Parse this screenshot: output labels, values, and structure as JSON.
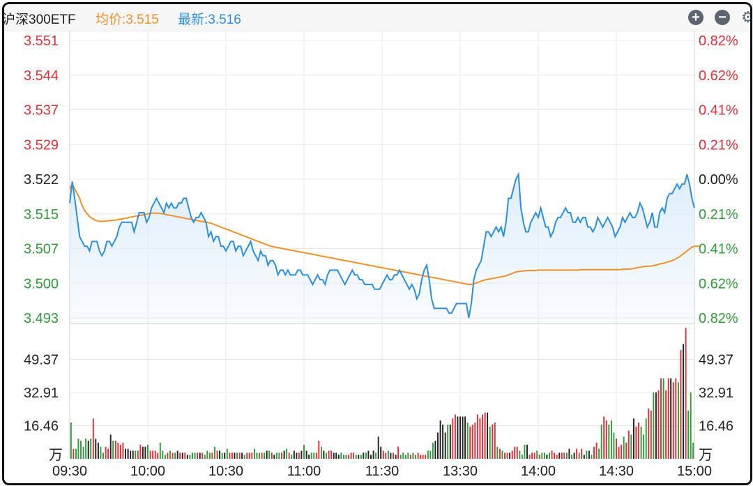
{
  "header": {
    "name": "沪深300ETF",
    "avg_label": "均价:3.515",
    "last_label": "最新:3.516",
    "zoom_in_icon": "plus-circle-icon",
    "zoom_out_icon": "minus-circle-icon",
    "settings_icon": "gear-icon"
  },
  "colors": {
    "up": "#e0303a",
    "down": "#2f9e3a",
    "flat": "#222222",
    "price_line": "#2b8fe0",
    "avg_line": "#f0902a",
    "area_fill": "#dcecfb",
    "grid": "#e8e8e8"
  },
  "chart_data": [
    {
      "type": "line",
      "name": "price",
      "base_price": 3.522,
      "price_ticks": [
        "3.551",
        "3.544",
        "3.537",
        "3.529",
        "3.522",
        "3.515",
        "3.507",
        "3.500",
        "3.493"
      ],
      "pct_ticks": [
        "0.82%",
        "0.62%",
        "0.41%",
        "0.21%",
        "0.00%",
        "0.21%",
        "0.41%",
        "0.62%",
        "0.82%"
      ],
      "ylim": [
        3.493,
        3.551
      ],
      "x_ticks": [
        "09:30",
        "10:00",
        "10:30",
        "11:00",
        "11:30",
        "13:30",
        "14:00",
        "14:30",
        "15:00"
      ],
      "series": [
        {
          "name": "最新",
          "values": [
            3.517,
            3.5215,
            3.518,
            3.514,
            3.51,
            3.509,
            3.508,
            3.508,
            3.507,
            3.509,
            3.509,
            3.509,
            3.507,
            3.506,
            3.507,
            3.509,
            3.509,
            3.508,
            3.509,
            3.51,
            3.512,
            3.513,
            3.513,
            3.513,
            3.513,
            3.513,
            3.511,
            3.513,
            3.515,
            3.515,
            3.515,
            3.513,
            3.514,
            3.516,
            3.517,
            3.518,
            3.517,
            3.516,
            3.515,
            3.517,
            3.516,
            3.517,
            3.516,
            3.516,
            3.517,
            3.517,
            3.518,
            3.518,
            3.516,
            3.514,
            3.513,
            3.514,
            3.514,
            3.515,
            3.514,
            3.513,
            3.51,
            3.511,
            3.509,
            3.51,
            3.51,
            3.508,
            3.508,
            3.507,
            3.508,
            3.509,
            3.509,
            3.507,
            3.508,
            3.508,
            3.506,
            3.507,
            3.508,
            3.509,
            3.507,
            3.506,
            3.505,
            3.507,
            3.506,
            3.506,
            3.504,
            3.505,
            3.505,
            3.504,
            3.502,
            3.503,
            3.503,
            3.502,
            3.503,
            3.502,
            3.502,
            3.502,
            3.503,
            3.503,
            3.502,
            3.502,
            3.502,
            3.501,
            3.5,
            3.501,
            3.502,
            3.501,
            3.501,
            3.5,
            3.502,
            3.503,
            3.503,
            3.503,
            3.503,
            3.502,
            3.501,
            3.5,
            3.501,
            3.502,
            3.503,
            3.502,
            3.502,
            3.501,
            3.501,
            3.5,
            3.5,
            3.5,
            3.5,
            3.499,
            3.499,
            3.499,
            3.5,
            3.501,
            3.502,
            3.501,
            3.501,
            3.502,
            3.502,
            3.503,
            3.502,
            3.501,
            3.5,
            3.499,
            3.5,
            3.499,
            3.497,
            3.498,
            3.501,
            3.503,
            3.504,
            3.501,
            3.497,
            3.495,
            3.495,
            3.495,
            3.495,
            3.495,
            3.495,
            3.494,
            3.494,
            3.495,
            3.496,
            3.496,
            3.496,
            3.496,
            3.496,
            3.493,
            3.496,
            3.501,
            3.503,
            3.504,
            3.505,
            3.508,
            3.511,
            3.511,
            3.51,
            3.511,
            3.512,
            3.511,
            3.512,
            3.51,
            3.513,
            3.518,
            3.518,
            3.52,
            3.522,
            3.523,
            3.516,
            3.513,
            3.511,
            3.511,
            3.513,
            3.514,
            3.515,
            3.514,
            3.516,
            3.514,
            3.512,
            3.512,
            3.51,
            3.511,
            3.513,
            3.514,
            3.514,
            3.515,
            3.516,
            3.515,
            3.515,
            3.513,
            3.513,
            3.514,
            3.513,
            3.514,
            3.514,
            3.512,
            3.512,
            3.511,
            3.512,
            3.514,
            3.513,
            3.512,
            3.513,
            3.514,
            3.513,
            3.512,
            3.51,
            3.511,
            3.512,
            3.514,
            3.513,
            3.514,
            3.515,
            3.514,
            3.514,
            3.515,
            3.517,
            3.516,
            3.514,
            3.512,
            3.513,
            3.515,
            3.512,
            3.512,
            3.515,
            3.516,
            3.515,
            3.518,
            3.519,
            3.519,
            3.52,
            3.521,
            3.52,
            3.521,
            3.521,
            3.523,
            3.521,
            3.518,
            3.516
          ]
        },
        {
          "name": "均价",
          "values": [
            3.52,
            3.521,
            3.52,
            3.519,
            3.518,
            3.5165,
            3.5155,
            3.5148,
            3.5142,
            3.5138,
            3.5135,
            3.5133,
            3.5132,
            3.5132,
            3.5132,
            3.5133,
            3.5133,
            3.5134,
            3.5134,
            3.5135,
            3.5136,
            3.5137,
            3.5138,
            3.5139,
            3.514,
            3.5141,
            3.5142,
            3.5143,
            3.5144,
            3.5145,
            3.5146,
            3.5147,
            3.5148,
            3.5149,
            3.5149,
            3.5149,
            3.5149,
            3.5148,
            3.5147,
            3.5146,
            3.5145,
            3.5144,
            3.5143,
            3.5142,
            3.5141,
            3.514,
            3.5139,
            3.5138,
            3.5137,
            3.5136,
            3.5135,
            3.5134,
            3.5133,
            3.5132,
            3.5131,
            3.513,
            3.5129,
            3.5128,
            3.5126,
            3.5124,
            3.5122,
            3.512,
            3.5118,
            3.5116,
            3.5114,
            3.5112,
            3.511,
            3.5108,
            3.5106,
            3.5104,
            3.5102,
            3.51,
            3.5098,
            3.5096,
            3.5094,
            3.5092,
            3.509,
            3.5088,
            3.5086,
            3.5084,
            3.5082,
            3.508,
            3.5079,
            3.5078,
            3.5077,
            3.5076,
            3.5075,
            3.5074,
            3.5073,
            3.5072,
            3.5071,
            3.507,
            3.5069,
            3.5068,
            3.5067,
            3.5066,
            3.5065,
            3.5064,
            3.5063,
            3.5062,
            3.5061,
            3.506,
            3.5059,
            3.5058,
            3.5057,
            3.5056,
            3.5055,
            3.5054,
            3.5053,
            3.5052,
            3.5051,
            3.505,
            3.5049,
            3.5048,
            3.5047,
            3.5046,
            3.5045,
            3.5044,
            3.5043,
            3.5042,
            3.5041,
            3.504,
            3.5039,
            3.5038,
            3.5037,
            3.5036,
            3.5035,
            3.5034,
            3.5033,
            3.5032,
            3.5031,
            3.503,
            3.5029,
            3.5028,
            3.5027,
            3.5026,
            3.5025,
            3.5024,
            3.5023,
            3.5022,
            3.5021,
            3.502,
            3.5019,
            3.5018,
            3.5017,
            3.5016,
            3.5015,
            3.5014,
            3.5013,
            3.5012,
            3.5011,
            3.501,
            3.5009,
            3.5008,
            3.5007,
            3.5006,
            3.5005,
            3.5004,
            3.5003,
            3.5002,
            3.5001,
            3.5,
            3.5,
            3.5001,
            3.5003,
            3.5005,
            3.5007,
            3.5009,
            3.501,
            3.5011,
            3.5012,
            3.5013,
            3.5014,
            3.5015,
            3.5016,
            3.5017,
            3.5018,
            3.502,
            3.5022,
            3.5024,
            3.5026,
            3.5027,
            3.5028,
            3.5028,
            3.5029,
            3.5029,
            3.5029,
            3.5029,
            3.5029,
            3.503,
            3.503,
            3.503,
            3.503,
            3.503,
            3.503,
            3.503,
            3.503,
            3.503,
            3.503,
            3.503,
            3.503,
            3.503,
            3.503,
            3.503,
            3.503,
            3.503,
            3.5031,
            3.5031,
            3.5031,
            3.5031,
            3.5031,
            3.5031,
            3.5031,
            3.5031,
            3.5031,
            3.5031,
            3.5031,
            3.5031,
            3.5031,
            3.5031,
            3.5031,
            3.5031,
            3.5031,
            3.5032,
            3.5032,
            3.5032,
            3.5032,
            3.5033,
            3.5034,
            3.5035,
            3.5036,
            3.5037,
            3.5038,
            3.5038,
            3.5038,
            3.5039,
            3.504,
            3.5041,
            3.5043,
            3.5044,
            3.5045,
            3.5047,
            3.5048,
            3.505,
            3.5052,
            3.5055,
            3.5058,
            3.5062,
            3.5066,
            3.507,
            3.5074,
            3.5078,
            3.508,
            3.508,
            3.508
          ]
        }
      ]
    },
    {
      "type": "bar",
      "name": "volume",
      "unit": "万",
      "y_ticks": [
        "49.37",
        "32.91",
        "16.46"
      ],
      "ylim": [
        0,
        65.8
      ],
      "x_ticks": [
        "09:30",
        "10:00",
        "10:30",
        "11:00",
        "11:30",
        "13:30",
        "14:00",
        "14:30",
        "15:00"
      ],
      "values": [
        18,
        5,
        5,
        10,
        9,
        6,
        10,
        9,
        10,
        20,
        10,
        8,
        6,
        3,
        6,
        5,
        12,
        9,
        9,
        8,
        7,
        8,
        5,
        5,
        4,
        4,
        4,
        4,
        7,
        6,
        6,
        7,
        4,
        4,
        4,
        3,
        8,
        4,
        2,
        3,
        4,
        3,
        3,
        4,
        3,
        3,
        3,
        2,
        2,
        3,
        3,
        3,
        3,
        3,
        2,
        4,
        3,
        3,
        6,
        4,
        4,
        3,
        3,
        5,
        3,
        3,
        3,
        3,
        3,
        3,
        2,
        3,
        3,
        3,
        5,
        3,
        3,
        3,
        3,
        4,
        4,
        3,
        2,
        3,
        3,
        3,
        4,
        5,
        3,
        2,
        4,
        3,
        3,
        4,
        7,
        4,
        2,
        3,
        3,
        3,
        9,
        6,
        4,
        3,
        4,
        4,
        3,
        3,
        2,
        3,
        2,
        2,
        2,
        3,
        3,
        2,
        2,
        2,
        3,
        3,
        4,
        2,
        4,
        3,
        11,
        6,
        4,
        3,
        4,
        3,
        3,
        2,
        6,
        2,
        3,
        2,
        3,
        2,
        3,
        2,
        3,
        2,
        2,
        2,
        4,
        4,
        8,
        9,
        13,
        19,
        17,
        13,
        17,
        17,
        20,
        22,
        21,
        21,
        21,
        21,
        18,
        16,
        17,
        18,
        22,
        20,
        22,
        23,
        23,
        16,
        17,
        18,
        6,
        5,
        4,
        3,
        3,
        3,
        4,
        6,
        6,
        4,
        2,
        7,
        7,
        2,
        3,
        3,
        4,
        2,
        3,
        3,
        2,
        3,
        4,
        3,
        2,
        3,
        3,
        3,
        3,
        5,
        2,
        3,
        5,
        3,
        5,
        2,
        4,
        4,
        2,
        6,
        8,
        5,
        17,
        21,
        19,
        17,
        19,
        13,
        10,
        6,
        7,
        11,
        8,
        14,
        12,
        20,
        16,
        18,
        16,
        12,
        20,
        25,
        24,
        33,
        33,
        34,
        40,
        40,
        34,
        40,
        40,
        38,
        40,
        38,
        54,
        57,
        65,
        24,
        33,
        8
      ]
    }
  ]
}
